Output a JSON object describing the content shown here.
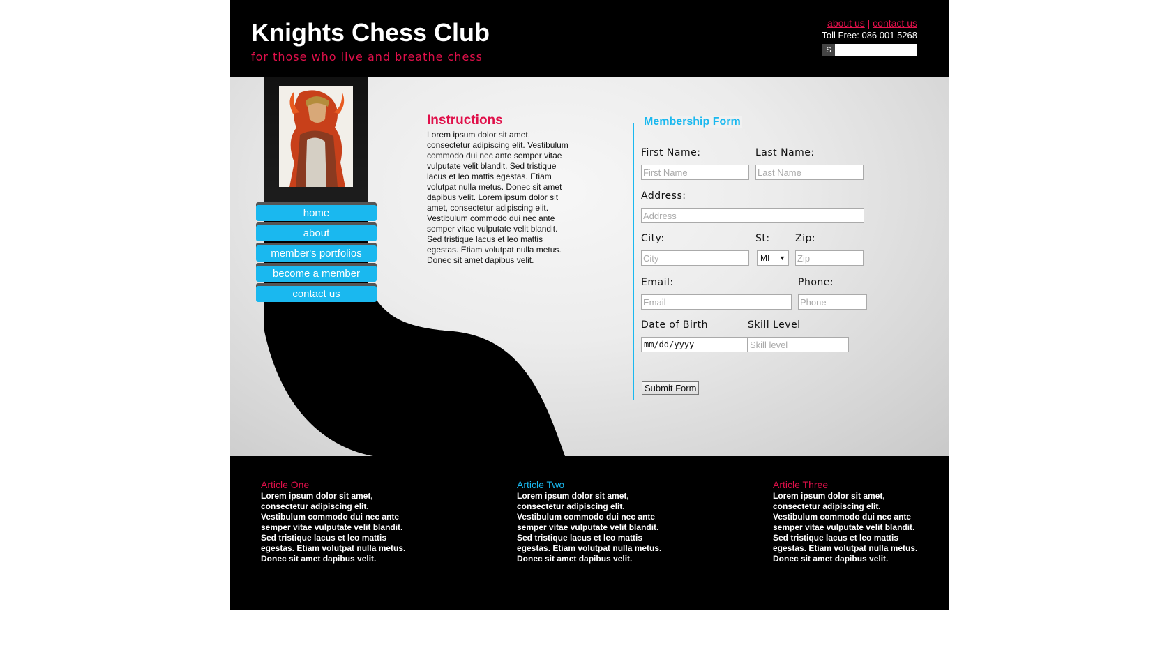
{
  "header": {
    "site_title": "Knights Chess Club",
    "tagline": "for those who live and breathe chess",
    "links": {
      "about": "about us",
      "separator": "|",
      "contact": "contact us"
    },
    "toll_free": "Toll Free: 086 001 5268",
    "search_button": "S",
    "search_placeholder": ""
  },
  "nav": {
    "items": [
      {
        "label": "home"
      },
      {
        "label": "about"
      },
      {
        "label": "member's portfolios"
      },
      {
        "label": "become a member"
      },
      {
        "label": "contact us"
      }
    ]
  },
  "instructions": {
    "title": "Instructions",
    "text": "Lorem ipsum dolor sit amet, consectetur adipiscing elit. Vestibulum commodo dui nec ante semper vitae vulputate velit blandit. Sed tristique lacus et leo mattis egestas. Etiam volutpat nulla metus. Donec sit amet dapibus velit. Lorem ipsum dolor sit amet, consectetur adipiscing elit. Vestibulum commodo dui nec ante semper vitae vulputate velit blandit. Sed tristique lacus et leo mattis egestas. Etiam volutpat nulla metus. Donec sit amet dapibus velit."
  },
  "form": {
    "legend": "Membership Form",
    "first_name": {
      "label": "First Name:",
      "placeholder": "First Name"
    },
    "last_name": {
      "label": "Last Name:",
      "placeholder": "Last Name"
    },
    "address": {
      "label": "Address:",
      "placeholder": "Address"
    },
    "city": {
      "label": "City:",
      "placeholder": "City"
    },
    "state": {
      "label": "St:",
      "value": "MI"
    },
    "zip": {
      "label": "Zip:",
      "placeholder": "Zip"
    },
    "email": {
      "label": "Email:",
      "placeholder": "Email"
    },
    "phone": {
      "label": "Phone:",
      "placeholder": "Phone"
    },
    "dob": {
      "label": "Date of Birth",
      "value": "mm/dd/yyyy"
    },
    "skill": {
      "label": "Skill Level",
      "placeholder": "Skill level"
    },
    "submit": "Submit Form"
  },
  "footer": {
    "articles": [
      {
        "title": "Article One",
        "color": "#e0104a",
        "text": "Lorem ipsum dolor sit amet, consectetur adipiscing elit. Vestibulum commodo dui nec ante semper vitae vulputate velit blandit. Sed tristique lacus et leo mattis egestas. Etiam volutpat nulla metus. Donec sit amet dapibus velit."
      },
      {
        "title": "Article Two",
        "color": "#1ab8ef",
        "text": "Lorem ipsum dolor sit amet, consectetur adipiscing elit. Vestibulum commodo dui nec ante semper vitae vulputate velit blandit. Sed tristique lacus et leo mattis egestas. Etiam volutpat nulla metus. Donec sit amet dapibus velit."
      },
      {
        "title": "Article Three",
        "color": "#e0104a",
        "text": "Lorem ipsum dolor sit amet, consectetur adipiscing elit. Vestibulum commodo dui nec ante semper vitae vulputate velit blandit. Sed tristique lacus et leo mattis egestas. Etiam volutpat nulla metus. Donec sit amet dapibus velit."
      }
    ]
  },
  "colors": {
    "accent_red": "#e0104a",
    "accent_blue": "#1ab8ef",
    "header_bg": "#000000"
  }
}
